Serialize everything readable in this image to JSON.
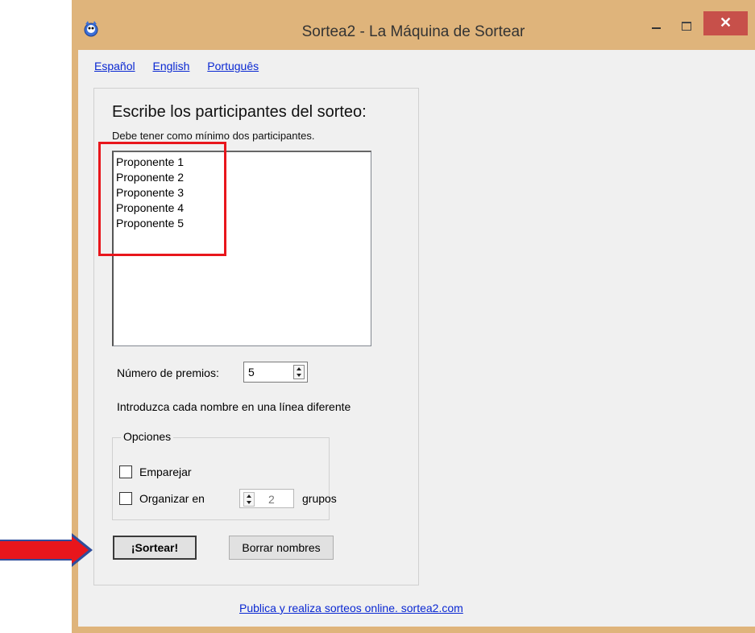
{
  "window": {
    "title": "Sortea2 - La Máquina de Sortear"
  },
  "languages": [
    "Español",
    "English",
    "Português"
  ],
  "main": {
    "heading": "Escribe los participantes del sorteo:",
    "subhint": "Debe tener como mínimo dos participantes.",
    "participants": [
      "Proponente 1",
      "Proponente 2",
      "Proponente 3",
      "Proponente 4",
      "Proponente 5"
    ],
    "prizes_label": "Número de premios:",
    "prizes_value": "5",
    "line_hint": "Introduzca cada nombre en una línea diferente",
    "options": {
      "legend": "Opciones",
      "pair_label": "Emparejar",
      "organize_label": "Organizar en",
      "groups_value": "2",
      "groups_label": "grupos"
    },
    "buttons": {
      "draw": "¡Sortear!",
      "clear": "Borrar nombres"
    }
  },
  "footer_link": "Publica y realiza sorteos online.  sortea2.com",
  "colors": {
    "annotation": "#e8161c",
    "titlebar": "#dfb47b",
    "link": "#0a28d2"
  }
}
